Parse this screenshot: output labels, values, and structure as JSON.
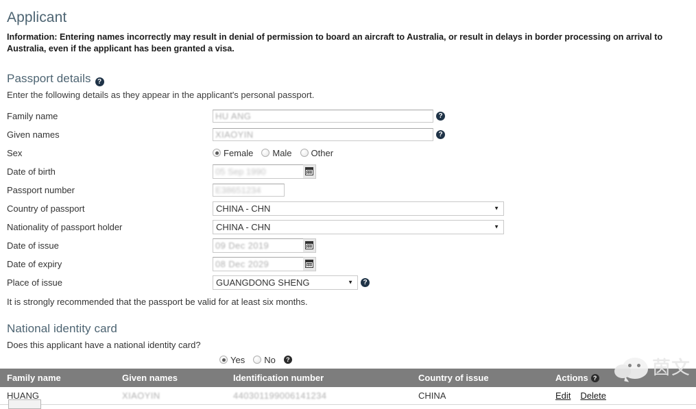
{
  "page": {
    "title": "Applicant",
    "information_notice": "Information: Entering names incorrectly may result in denial of permission to board an aircraft to Australia, or result in delays in border processing on arrival to Australia, even if the applicant has been granted a visa."
  },
  "passport_section": {
    "heading": "Passport details",
    "help_icon": "help-icon",
    "lead": "Enter the following details as they appear in the applicant's personal passport.",
    "fields": {
      "family_name": {
        "label": "Family name",
        "value": "HU ANG",
        "help_icon": "help-icon"
      },
      "given_names": {
        "label": "Given names",
        "value": "XIAOYIN",
        "help_icon": "help-icon"
      },
      "sex": {
        "label": "Sex",
        "options": [
          "Female",
          "Male",
          "Other"
        ],
        "selected": "Female"
      },
      "date_of_birth": {
        "label": "Date of birth",
        "value": "05 Sep 1990",
        "calendar_icon": "calendar-icon"
      },
      "passport_number": {
        "label": "Passport number",
        "value": "E38651234"
      },
      "country_of_passport": {
        "label": "Country of passport",
        "value": "CHINA - CHN",
        "dropdown_icon": "chevron-down-icon"
      },
      "nationality": {
        "label": "Nationality of passport holder",
        "value": "CHINA - CHN",
        "dropdown_icon": "chevron-down-icon"
      },
      "date_of_issue": {
        "label": "Date of issue",
        "value": "09 Dec 2019",
        "calendar_icon": "calendar-icon"
      },
      "date_of_expiry": {
        "label": "Date of expiry",
        "value": "08 Dec 2029",
        "calendar_icon": "calendar-icon"
      },
      "place_of_issue": {
        "label": "Place of issue",
        "value": "GUANGDONG SHENG",
        "dropdown_icon": "chevron-down-icon",
        "help_icon": "help-icon"
      }
    },
    "recommendation": "It is strongly recommended that the passport be valid for at least six months."
  },
  "identity_section": {
    "heading": "National identity card",
    "question": "Does this applicant have a national identity card?",
    "options": [
      "Yes",
      "No"
    ],
    "selected": "Yes",
    "help_icon": "help-icon",
    "table": {
      "columns": [
        "Family name",
        "Given names",
        "Identification number",
        "Country of issue",
        "Actions"
      ],
      "actions_help_icon": "help-icon",
      "rows": [
        {
          "family_name": "HUANG",
          "given_names": "XIAOYIN",
          "identification_number": "440301199006141234",
          "country_of_issue": "CHINA",
          "actions": [
            "Edit",
            "Delete"
          ]
        }
      ]
    }
  },
  "watermark": {
    "icon": "wechat-icon",
    "text": "茵文"
  },
  "colors": {
    "heading": "#4d6472",
    "table_header_bg": "#7d7d7d",
    "help_icon_bg": "#1f3347",
    "body_text": "#333333"
  }
}
